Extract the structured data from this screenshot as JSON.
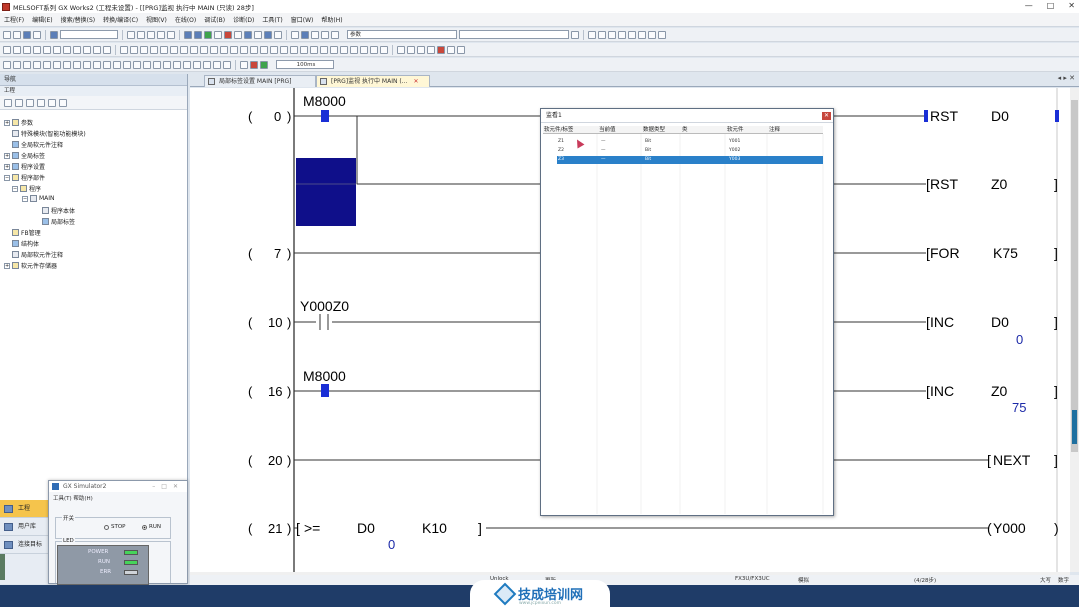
{
  "window": {
    "title": "MELSOFT系列 GX Works2 (工程未设置) - [[PRG]监视 执行中 MAIN (只读) 28步]",
    "controls": [
      "—",
      "□",
      "✕"
    ]
  },
  "menu": [
    "工程(F)",
    "编辑(E)",
    "搜索/替换(S)",
    "转换/编译(C)",
    "视图(V)",
    "在线(O)",
    "调试(B)",
    "诊断(D)",
    "工具(T)",
    "窗口(W)",
    "帮助(H)"
  ],
  "toolbar": {
    "combo_param": "参数",
    "combo_mode": "",
    "zoom": "100ms"
  },
  "nav": {
    "title": "导航",
    "section": "工程",
    "tree": [
      "参数",
      "特殊模块(智能功能模块)",
      "全局软元件注释",
      "全局标签",
      "程序设置",
      "程序部件",
      "程序",
      "MAIN",
      "程序本体",
      "局部标签",
      "FB管理",
      "结构体",
      "局部软元件注释",
      "软元件存储器"
    ],
    "tabs": [
      "工程",
      "用户库",
      "连接目标"
    ]
  },
  "sim": {
    "title": "GX Simulator2",
    "menu": "工具(T)  帮助(H)",
    "switch_label": "开关",
    "stop": "STOP",
    "run": "RUN",
    "led_label": "LED",
    "leds": [
      "POWER",
      "RUN",
      "ERR"
    ],
    "led_colors": [
      "#46d35a",
      "#46d35a",
      "#cfd3d8"
    ]
  },
  "tabs": [
    {
      "label": "局部标签设置 MAIN [PRG]"
    },
    {
      "label": "[PRG]监视 执行中 MAIN (..."
    }
  ],
  "tab_arrows": "◂ ▸ ✕",
  "ladder": {
    "steps": [
      "0",
      "7",
      "10",
      "16",
      "20",
      "21"
    ],
    "devices": {
      "m8000_a": "M8000",
      "y000z0": "Y000Z0",
      "m8000_b": "M8000"
    },
    "instructions": [
      {
        "op": "RST",
        "arg": "D0",
        "val": ""
      },
      {
        "op": "RST",
        "arg": "Z0",
        "val": ""
      },
      {
        "op": "FOR",
        "arg": "K75",
        "val": ""
      },
      {
        "op": "INC",
        "arg": "D0",
        "val": "0"
      },
      {
        "op": "INC",
        "arg": "Z0",
        "val": "75"
      },
      {
        "op": "NEXT",
        "arg": "",
        "val": ""
      }
    ],
    "compare": {
      "op": ">=",
      "a": "D0",
      "b": "K10",
      "a_val": "0"
    },
    "coil": "Y000"
  },
  "watch": {
    "title": "监看1",
    "headers": [
      "软元件/标签",
      "当前值",
      "数据类型",
      "类",
      "软元件",
      "注释"
    ],
    "rows": [
      [
        "Z1",
        "—",
        "Bit",
        "",
        "Y001",
        ""
      ],
      [
        "Z2",
        "—",
        "Bit",
        "",
        "Y002",
        ""
      ],
      [
        "Z3",
        "—",
        "Bit",
        "",
        "Y003",
        ""
      ]
    ]
  },
  "status": {
    "cpu": "FX3U/FX3UC",
    "mode": "模拟",
    "steps": "(4/28步)",
    "state": "大写",
    "num": "数字",
    "left1": "Unlock",
    "left2": "更新"
  },
  "watermark": {
    "text": "技成培训网",
    "sub": "www.jcpeixun.com"
  }
}
